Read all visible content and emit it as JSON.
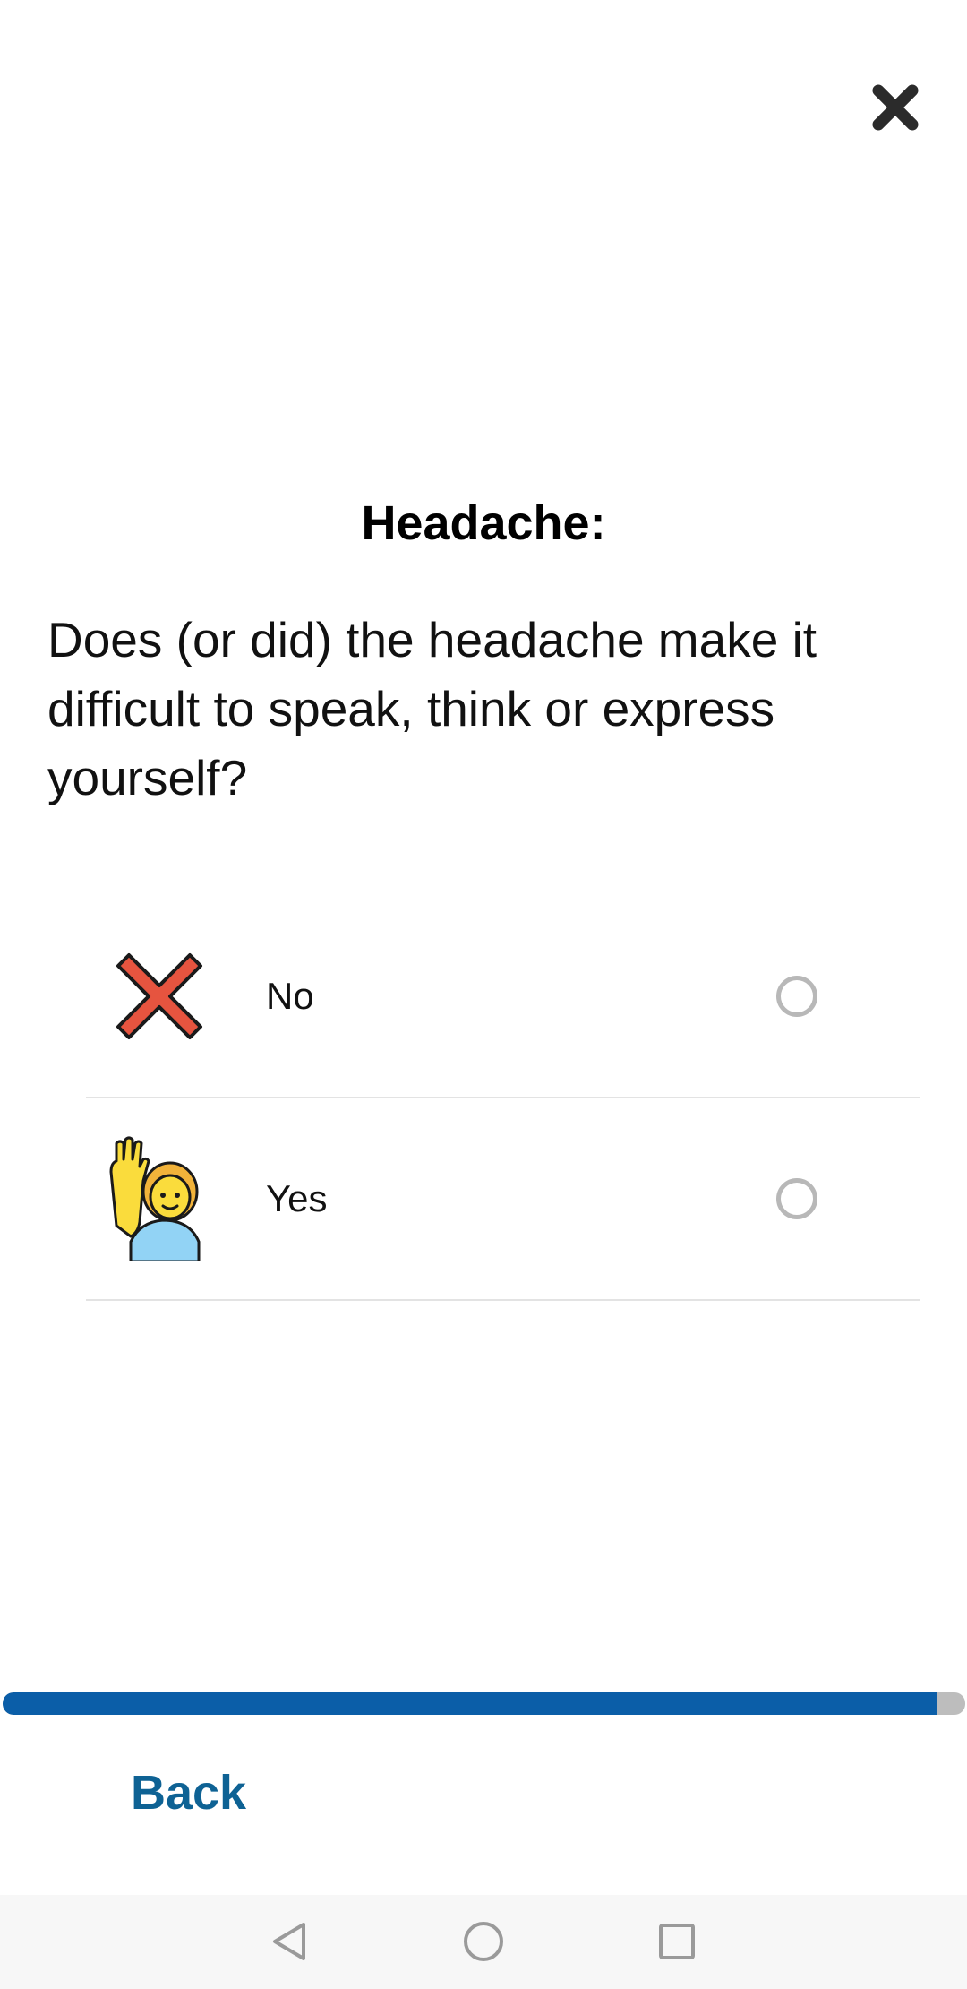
{
  "header": {
    "close_icon": "close-icon"
  },
  "question": {
    "title": "Headache:",
    "text": "Does (or did) the headache make it difficult to speak, think or express yourself?"
  },
  "options": [
    {
      "label": "No",
      "icon": "cross-mark-icon",
      "selected": false
    },
    {
      "label": "Yes",
      "icon": "raising-hand-icon",
      "selected": false
    }
  ],
  "progress": {
    "fraction": 0.97,
    "color": "#0b5ea8",
    "track_color": "#bdbdbd"
  },
  "footer": {
    "back_label": "Back",
    "back_color": "#0e6294"
  },
  "nav_bar": {
    "icons": [
      "nav-back-icon",
      "nav-home-icon",
      "nav-recents-icon"
    ]
  }
}
